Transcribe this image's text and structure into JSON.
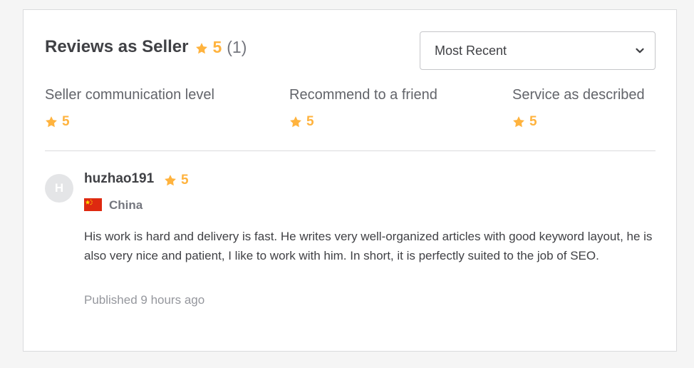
{
  "header": {
    "title": "Reviews as Seller",
    "rating": "5",
    "count": "(1)"
  },
  "sort": {
    "selected": "Most Recent"
  },
  "breakdown": [
    {
      "label": "Seller communication level",
      "rating": "5"
    },
    {
      "label": "Recommend to a friend",
      "rating": "5"
    },
    {
      "label": "Service as described",
      "rating": "5"
    }
  ],
  "review": {
    "avatar_initial": "H",
    "username": "huzhao191",
    "rating": "5",
    "country": "China",
    "text": "His work is hard and delivery is fast. He writes very well-organized articles with good keyword layout, he is also very nice and patient, I like to work with him. In short, it is perfectly suited to the job of SEO.",
    "published": "Published 9 hours ago"
  },
  "colors": {
    "star": "#ffb33e",
    "text": "#404145",
    "muted": "#74767e",
    "border": "#dadbdd"
  },
  "icons": {
    "star": "star-icon",
    "chevron": "chevron-down-icon",
    "flag": "china-flag-icon"
  }
}
